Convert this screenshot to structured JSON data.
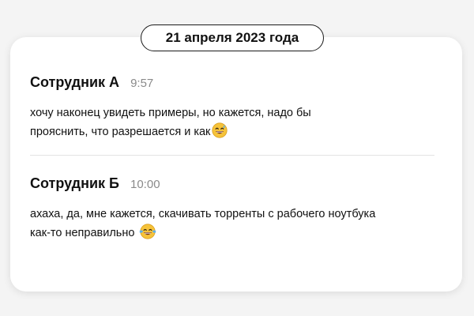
{
  "date_separator": {
    "label": "21 апреля 2023 года"
  },
  "messages": [
    {
      "author": "Сотрудник А",
      "time": "9:57",
      "text_line1": "хочу наконец увидеть примеры, но кажется, надо бы",
      "text_line2": "прояснить, что разрешается и как",
      "emoji": "grinning-sweat-emoji"
    },
    {
      "author": "Сотрудник Б",
      "time": "10:00",
      "text_line1": "ахаха, да, мне кажется, скачивать торренты с рабочего ноутбука",
      "text_line2": "как-то неправильно",
      "emoji": "tears-of-joy-emoji"
    }
  ],
  "colors": {
    "background": "#f4f4f4",
    "card": "#ffffff",
    "text": "#111111",
    "timestamp": "#8a8a8a",
    "emoji_face": "#f6c33a"
  }
}
